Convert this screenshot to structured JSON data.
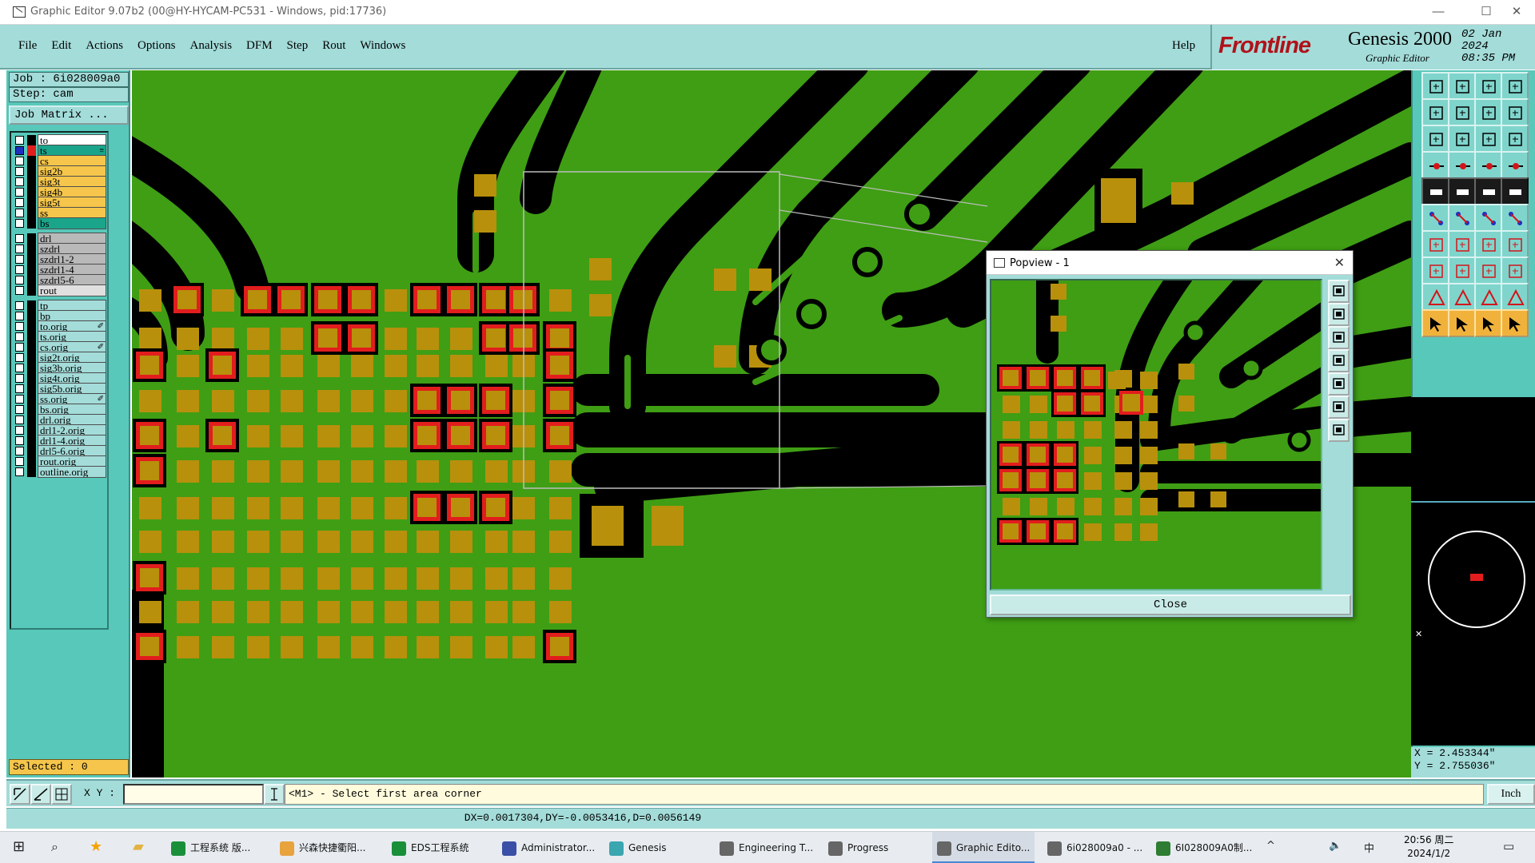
{
  "window": {
    "title": "Graphic Editor 9.07b2 (00@HY-HYCAM-PC531 - Windows, pid:17736)",
    "minimize": "—",
    "maximize": "☐",
    "close": "✕"
  },
  "menu": {
    "items": [
      "File",
      "Edit",
      "Actions",
      "Options",
      "Analysis",
      "DFM",
      "Step",
      "Rout",
      "Windows"
    ],
    "help": "Help"
  },
  "brand": {
    "logo": "Frontline",
    "product": "Genesis 2000",
    "subtitle": "Graphic Editor",
    "date": "02 Jan 2024",
    "time": "08:35 PM"
  },
  "job": {
    "job_label": "Job : 6i028009a0",
    "step_label": "Step: cam",
    "job_matrix_button": "Job Matrix ..."
  },
  "layers": [
    {
      "name": "to",
      "color": "#ffffff",
      "swatch": "#000000"
    },
    {
      "name": "ts",
      "color": "#1aa58a",
      "swatch": "#e21d1d",
      "active": true,
      "mark": "≡"
    },
    {
      "name": "cs",
      "color": "#f5c64b",
      "swatch": "#000000"
    },
    {
      "name": "sig2b",
      "color": "#f5c64b",
      "swatch": "#000000"
    },
    {
      "name": "sig3t",
      "color": "#f5c64b",
      "swatch": "#000000"
    },
    {
      "name": "sig4b",
      "color": "#f5c64b",
      "swatch": "#000000"
    },
    {
      "name": "sig5t",
      "color": "#f5c64b",
      "swatch": "#000000"
    },
    {
      "name": "ss",
      "color": "#f5c64b",
      "swatch": "#000000"
    },
    {
      "name": "bs",
      "color": "#1aa58a",
      "swatch": "#000000"
    },
    {
      "name": "drl",
      "color": "#b9b9b9",
      "swatch": "#000000"
    },
    {
      "name": "szdrl",
      "color": "#b9b9b9",
      "swatch": "#000000"
    },
    {
      "name": "szdrl1-2",
      "color": "#b9b9b9",
      "swatch": "#000000"
    },
    {
      "name": "szdrl1-4",
      "color": "#b9b9b9",
      "swatch": "#000000"
    },
    {
      "name": "szdrl5-6",
      "color": "#b9b9b9",
      "swatch": "#000000"
    },
    {
      "name": "rout",
      "color": "#e0e0e0",
      "swatch": "#000000"
    },
    {
      "name": "tp",
      "color": "#a3dcd9",
      "swatch": "#000000"
    },
    {
      "name": "bp",
      "color": "#a3dcd9",
      "swatch": "#000000"
    },
    {
      "name": "to.orig",
      "color": "#a3dcd9",
      "swatch": "#000000",
      "mark": "✐"
    },
    {
      "name": "ts.orig",
      "color": "#a3dcd9",
      "swatch": "#000000"
    },
    {
      "name": "cs.orig",
      "color": "#a3dcd9",
      "swatch": "#000000",
      "mark": "✐"
    },
    {
      "name": "sig2t.orig",
      "color": "#a3dcd9",
      "swatch": "#000000"
    },
    {
      "name": "sig3b.orig",
      "color": "#a3dcd9",
      "swatch": "#000000"
    },
    {
      "name": "sig4t.orig",
      "color": "#a3dcd9",
      "swatch": "#000000"
    },
    {
      "name": "sig5b.orig",
      "color": "#a3dcd9",
      "swatch": "#000000"
    },
    {
      "name": "ss.orig",
      "color": "#a3dcd9",
      "swatch": "#000000",
      "mark": "✐"
    },
    {
      "name": "bs.orig",
      "color": "#a3dcd9",
      "swatch": "#000000"
    },
    {
      "name": "drl.orig",
      "color": "#a3dcd9",
      "swatch": "#000000"
    },
    {
      "name": "drl1-2.orig",
      "color": "#a3dcd9",
      "swatch": "#000000"
    },
    {
      "name": "drl1-4.orig",
      "color": "#a3dcd9",
      "swatch": "#000000"
    },
    {
      "name": "drl5-6.orig",
      "color": "#a3dcd9",
      "swatch": "#000000"
    },
    {
      "name": "rout.orig",
      "color": "#a3dcd9",
      "swatch": "#000000"
    },
    {
      "name": "outline.orig",
      "color": "#a3dcd9",
      "swatch": "#000000"
    }
  ],
  "selected_label": "Selected : 0",
  "command": {
    "xy_label": "X Y :",
    "xy_value": "",
    "prompt": "<M1> - Select first area corner",
    "units": "Inch"
  },
  "status_bar": "DX=0.0017304,DY=-0.0053416,D=0.0056149",
  "coordinates": {
    "x": "X = 2.453344\"",
    "y": "Y = 2.755036\""
  },
  "popview": {
    "title": "Popview - 1",
    "close_button": "Close"
  },
  "taskbar": {
    "items": [
      {
        "label": "工程系统  版...",
        "icon_color": "#1a8f3a"
      },
      {
        "label": "兴森快捷衢阳...",
        "icon_color": "#e8a33d"
      },
      {
        "label": "EDS工程系统",
        "icon_color": "#1a8f3a"
      },
      {
        "label": "Administrator...",
        "icon_color": "#3a4fa6"
      },
      {
        "label": "Genesis",
        "icon_color": "#3aa6b0"
      },
      {
        "label": "Engineering T...",
        "icon_color": "#666666"
      },
      {
        "label": "Progress",
        "icon_color": "#666666"
      },
      {
        "label": "Graphic Edito...",
        "icon_color": "#666666",
        "active": true
      },
      {
        "label": "6i028009a0 - ...",
        "icon_color": "#666666"
      },
      {
        "label": "6I028009A0制...",
        "icon_color": "#2e7d32"
      }
    ],
    "ime": "中",
    "time": "20:56 周二",
    "date": "2024/1/2"
  },
  "colors": {
    "board": "#3f9e14",
    "copper_clear": "#000000",
    "pad": "#b8900c",
    "pad_highlight": "#e21d1d",
    "panel": "#a3dcd9",
    "panel_dark": "#58c8ba"
  }
}
